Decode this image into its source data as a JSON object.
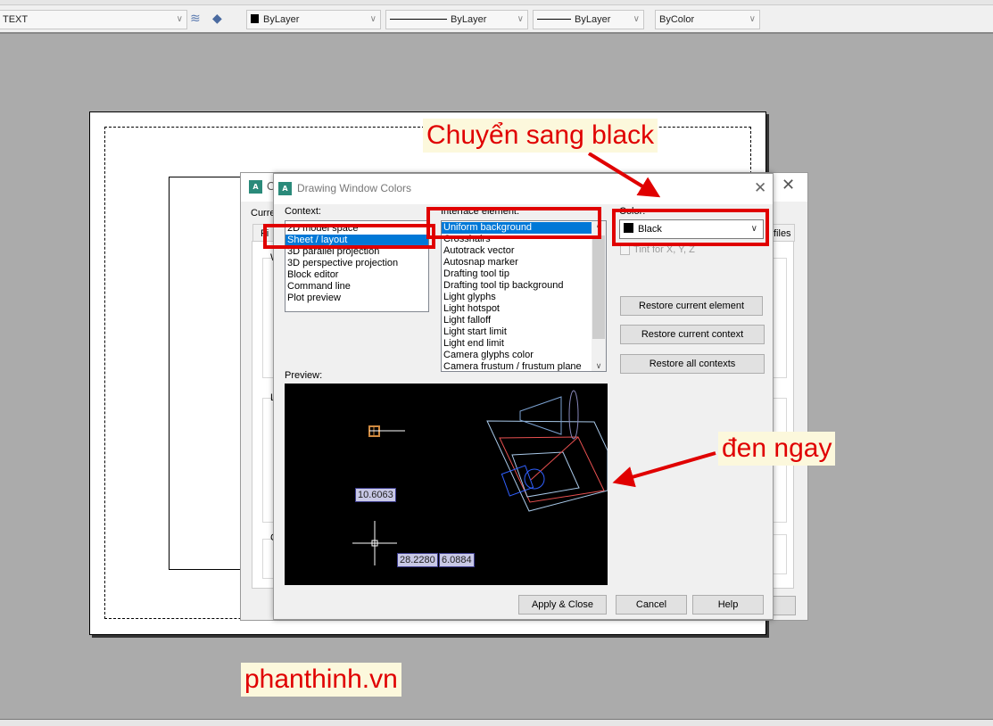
{
  "toolbar": {
    "text_style": "TEXT",
    "color": "ByLayer",
    "linetype": "ByLayer",
    "lineweight": "ByLayer",
    "plotstyle": "ByColor"
  },
  "options_dialog": {
    "title_fragment": "O",
    "current_label_fragment": "Curre",
    "tab_fragment": "Fi",
    "tab_files_fragment": "files",
    "group_fragments": [
      "W",
      "L",
      "C"
    ]
  },
  "dwc_dialog": {
    "title": "Drawing Window Colors",
    "context_label": "Context:",
    "context_items": [
      "2D model space",
      "Sheet / layout",
      "3D parallel projection",
      "3D perspective projection",
      "Block editor",
      "Command line",
      "Plot preview"
    ],
    "context_selected": "Sheet / layout",
    "element_label": "Interface element:",
    "element_items": [
      "Uniform background",
      "Crosshairs",
      "Autotrack vector",
      "Autosnap marker",
      "Drafting tool tip",
      "Drafting tool tip background",
      "Light glyphs",
      "Light hotspot",
      "Light falloff",
      "Light start limit",
      "Light end limit",
      "Camera glyphs color",
      "Camera frustum / frustum plane"
    ],
    "element_selected": "Uniform background",
    "color_label": "Color:",
    "color_value": "Black",
    "tint_label": "Tint for X, Y, Z",
    "restore_element": "Restore current element",
    "restore_context": "Restore current context",
    "restore_all": "Restore all contexts",
    "preview_label": "Preview:",
    "preview_values": [
      "10.6063",
      "28.2280",
      "6.0884"
    ],
    "apply_close": "Apply & Close",
    "cancel": "Cancel",
    "help": "Help"
  },
  "annotations": {
    "note_top": "Chuyển sang black",
    "note_right": "đen ngay",
    "watermark": "phanthinh.vn",
    "accent": "#e00000"
  }
}
